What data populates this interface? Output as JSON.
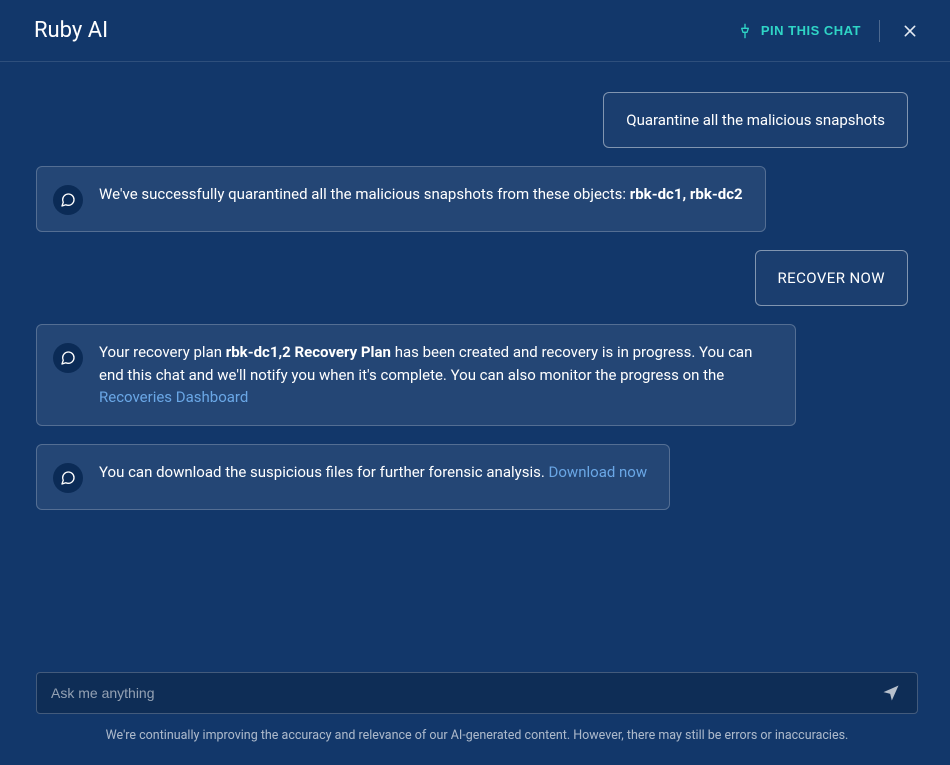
{
  "header": {
    "title": "Ruby AI",
    "pin_label": "PIN THIS CHAT"
  },
  "messages": {
    "user1": "Quarantine all the malicious snapshots",
    "ai1_prefix": "We've successfully quarantined all the malicious snapshots from these objects: ",
    "ai1_strong": "rbk-dc1, rbk-dc2",
    "user2": "RECOVER NOW",
    "ai2_prefix": "Your recovery plan ",
    "ai2_strong": "rbk-dc1,2 Recovery Plan",
    "ai2_mid": " has been created and recovery is in progress. You can end this chat and we'll notify you when it's complete.  You can also monitor the progress on the ",
    "ai2_link": "Recoveries Dashboard",
    "ai3_prefix": "You can download the suspicious files for further forensic analysis. ",
    "ai3_link": "Download now"
  },
  "composer": {
    "placeholder": "Ask me anything"
  },
  "disclaimer": "We're continually improving the accuracy and relevance of our AI-generated content. However, there may still be errors or inaccuracies."
}
